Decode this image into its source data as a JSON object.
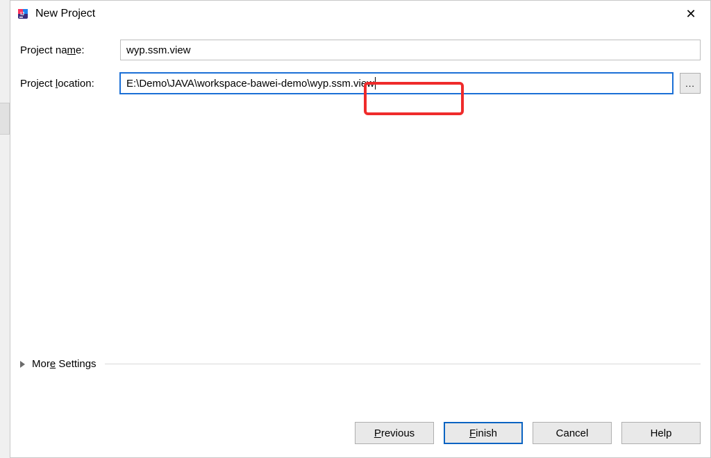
{
  "window": {
    "title": "New Project",
    "close_glyph": "✕"
  },
  "fields": {
    "name_label_pre": "Project na",
    "name_label_mn": "m",
    "name_label_post": "e:",
    "name_value": "wyp.ssm.view",
    "location_label_pre": "Project ",
    "location_label_mn": "l",
    "location_label_post": "ocation:",
    "location_value": "E:\\Demo\\JAVA\\workspace-bawei-demo\\wyp.ssm.view",
    "location_prefix": "E:\\Demo\\JAVA\\workspace-bawei-demo\\",
    "location_highlight": "wyp.ssm.view",
    "browse_label": "..."
  },
  "more": {
    "label_pre": "Mor",
    "label_mn": "e",
    "label_post": " Settings"
  },
  "buttons": {
    "previous_mn": "P",
    "previous_post": "revious",
    "finish_mn": "F",
    "finish_post": "inish",
    "cancel": "Cancel",
    "help": "Help"
  }
}
